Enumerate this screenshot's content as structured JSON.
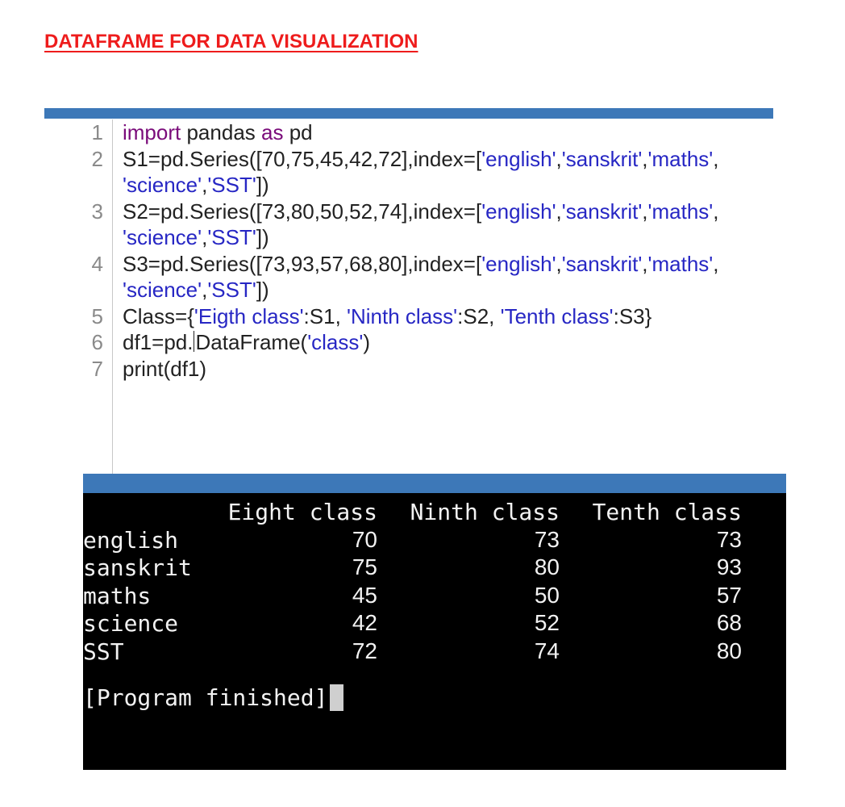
{
  "document": {
    "title": "DATAFRAME FOR DATA VISUALIZATION"
  },
  "colors": {
    "title": "#ee1c1c",
    "panel_bar": "#3d78b8",
    "keyword": "#7a0b7a",
    "string": "#2727c4",
    "terminal_bg": "#000000"
  },
  "code": {
    "lines": [
      {
        "number": "1",
        "segments": [
          {
            "t": "import",
            "k": "kw"
          },
          {
            "t": " pandas ",
            "k": "plain"
          },
          {
            "t": "as",
            "k": "kw"
          },
          {
            "t": " pd",
            "k": "plain"
          }
        ]
      },
      {
        "number": "2",
        "segments": [
          {
            "t": "S1=pd.Series([70,75,45,42,72],index=[",
            "k": "plain"
          },
          {
            "t": "'english'",
            "k": "str"
          },
          {
            "t": ",",
            "k": "plain"
          },
          {
            "t": "'sanskrit'",
            "k": "str"
          },
          {
            "t": ",",
            "k": "plain"
          },
          {
            "t": "'maths'",
            "k": "str"
          },
          {
            "t": ", ",
            "k": "plain"
          },
          {
            "t": "'science'",
            "k": "str"
          },
          {
            "t": ",",
            "k": "plain"
          },
          {
            "t": "'SST'",
            "k": "str"
          },
          {
            "t": "])",
            "k": "plain"
          }
        ]
      },
      {
        "number": "3",
        "segments": [
          {
            "t": "S2=pd.Series([73,80,50,52,74],index=[",
            "k": "plain"
          },
          {
            "t": "'english'",
            "k": "str"
          },
          {
            "t": ",",
            "k": "plain"
          },
          {
            "t": "'sanskrit'",
            "k": "str"
          },
          {
            "t": ",",
            "k": "plain"
          },
          {
            "t": "'maths'",
            "k": "str"
          },
          {
            "t": ", ",
            "k": "plain"
          },
          {
            "t": "'science'",
            "k": "str"
          },
          {
            "t": ",",
            "k": "plain"
          },
          {
            "t": "'SST'",
            "k": "str"
          },
          {
            "t": "])",
            "k": "plain"
          }
        ]
      },
      {
        "number": "4",
        "segments": [
          {
            "t": "S3=pd.Series([73,93,57,68,80],index=[",
            "k": "plain"
          },
          {
            "t": "'english'",
            "k": "str"
          },
          {
            "t": ",",
            "k": "plain"
          },
          {
            "t": "'sanskrit'",
            "k": "str"
          },
          {
            "t": ",",
            "k": "plain"
          },
          {
            "t": "'maths'",
            "k": "str"
          },
          {
            "t": ", ",
            "k": "plain"
          },
          {
            "t": "'science'",
            "k": "str"
          },
          {
            "t": ",",
            "k": "plain"
          },
          {
            "t": "'SST'",
            "k": "str"
          },
          {
            "t": "])",
            "k": "plain"
          }
        ]
      },
      {
        "number": "5",
        "segments": [
          {
            "t": "Class={",
            "k": "plain"
          },
          {
            "t": "'Eigth class'",
            "k": "str"
          },
          {
            "t": ":S1, ",
            "k": "plain"
          },
          {
            "t": "'Ninth class'",
            "k": "str"
          },
          {
            "t": ":S2, ",
            "k": "plain"
          },
          {
            "t": "'Tenth class'",
            "k": "str"
          },
          {
            "t": ":S3}",
            "k": "plain"
          }
        ]
      },
      {
        "number": "6",
        "segments": [
          {
            "t": "df1=pd.",
            "k": "plain"
          },
          {
            "t": "",
            "k": "caret"
          },
          {
            "t": "DataFrame(",
            "k": "plain"
          },
          {
            "t": "'class'",
            "k": "str"
          },
          {
            "t": ")",
            "k": "plain"
          }
        ]
      },
      {
        "number": "7",
        "segments": [
          {
            "t": "print(df1)",
            "k": "plain"
          }
        ]
      }
    ]
  },
  "terminal": {
    "headers": [
      "",
      "Eight class",
      "Ninth class",
      "Tenth class"
    ],
    "rows": [
      {
        "label": "english",
        "values": [
          "70",
          "73",
          "73"
        ]
      },
      {
        "label": "sanskrit",
        "values": [
          "75",
          "80",
          "93"
        ]
      },
      {
        "label": "maths",
        "values": [
          "45",
          "50",
          "57"
        ]
      },
      {
        "label": "science",
        "values": [
          "42",
          "52",
          "68"
        ]
      },
      {
        "label": "SST",
        "values": [
          "72",
          "74",
          "80"
        ]
      }
    ],
    "finished_text": "[Program finished]"
  }
}
